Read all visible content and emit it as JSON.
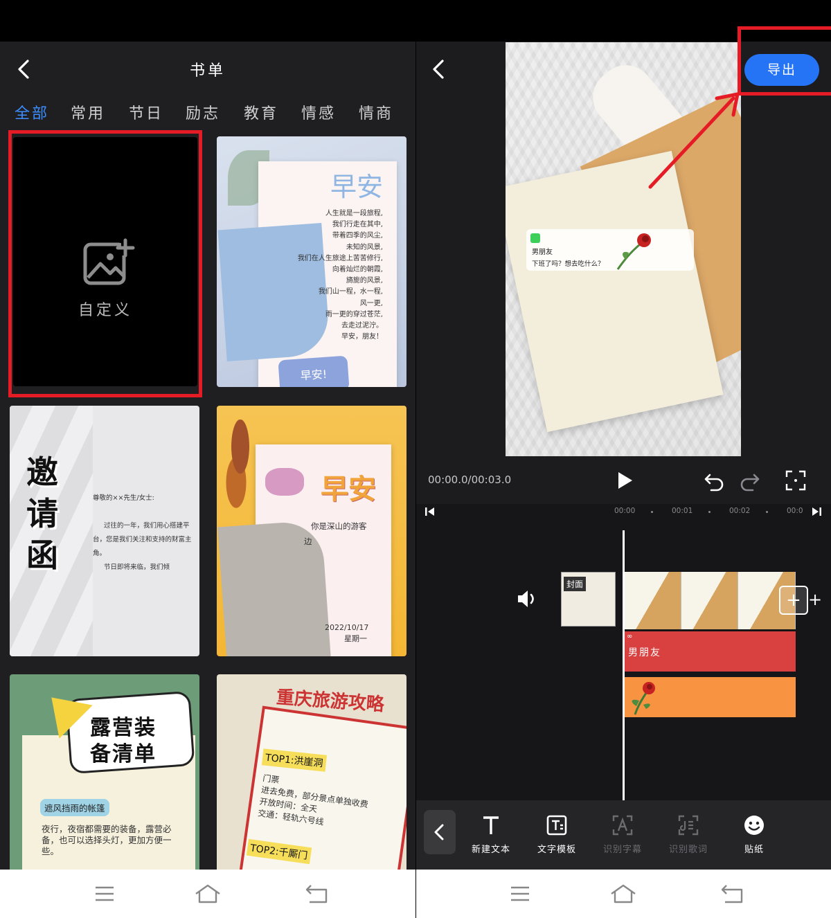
{
  "left": {
    "title": "书单",
    "tabs": [
      "全部",
      "常用",
      "节日",
      "励志",
      "教育",
      "情感",
      "情商"
    ],
    "active_tab": "全部",
    "custom_card": {
      "label": "自定义"
    },
    "templates": {
      "morning": {
        "title": "早安",
        "poem": [
          "人生就是一段旅程,",
          "我们行走在其中,",
          "带着四季的风尘,",
          "未知的风景,",
          "我们在人生旅途上苦苦修行,",
          "向着灿烂的朝霞,",
          "旖旎的风景,",
          "我们山一程，水一程,",
          "风一更,",
          "雨一更的穿过苍茫,",
          "去走过泥泞。",
          "早安，朋友！"
        ],
        "badge": "早安!"
      },
      "invite": {
        "big": [
          "邀",
          "请",
          "函"
        ],
        "lines": [
          "尊敬的××先生/女士:",
          "过往的一年，我们用心搭建平",
          "台，您是我们关注和支持的财富主",
          "角。",
          "节日即将来临，我们倾"
        ]
      },
      "hello": {
        "title": "早安",
        "line1": "你是深山的游客",
        "line2": "边",
        "date": "2022/10/17",
        "weekday": "星期一"
      },
      "camp": {
        "title1": "露营装",
        "title2": "备清单",
        "tag": "遮风挡雨的帐篷",
        "desc": "夜行，夜宿都需要的装备，露营必备，也可以选择头灯，更加方便一些。"
      },
      "travel": {
        "title": "重庆旅游攻略",
        "label1": "TOP1:洪崖洞",
        "info": [
          "门票",
          "进去免费，部分景点单独收费",
          "开放时间：全天",
          "交通：轻轨六号线"
        ],
        "label2": "TOP2:千厮门"
      }
    }
  },
  "right": {
    "export_label": "导出",
    "preview": {
      "msg_name": "男朋友",
      "msg_text": "下班了吗？想去吃什么？"
    },
    "timecode": "00:00.0/00:03.0",
    "ruler_ticks": [
      "00:00",
      "00:01",
      "00:02",
      "00:0"
    ],
    "cover_label": "封面",
    "text_track_label": "男朋友",
    "tools": [
      {
        "label": "新建文本",
        "icon": "text-icon",
        "enabled": true
      },
      {
        "label": "文字模板",
        "icon": "text-template-icon",
        "enabled": true
      },
      {
        "label": "识别字幕",
        "icon": "recognize-subtitle-icon",
        "enabled": false
      },
      {
        "label": "识别歌词",
        "icon": "recognize-lyrics-icon",
        "enabled": false
      },
      {
        "label": "贴纸",
        "icon": "sticker-icon",
        "enabled": true
      }
    ]
  },
  "colors": {
    "accent_blue": "#2674f6",
    "tab_active": "#3c8dff",
    "highlight_red": "#e51b25",
    "text_track": "#d94040",
    "sticker_track": "#f79341"
  }
}
